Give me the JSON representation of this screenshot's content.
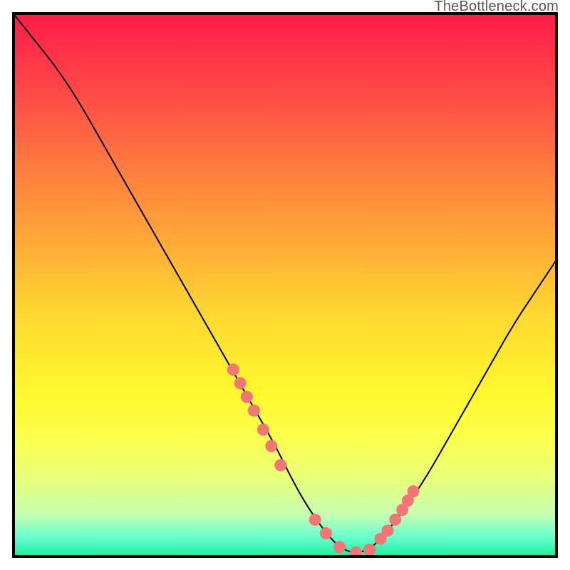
{
  "watermark": "TheBottleneck.com",
  "chart_data": {
    "type": "line",
    "title": "",
    "xlabel": "",
    "ylabel": "",
    "xlim": [
      0,
      100
    ],
    "ylim": [
      0,
      100
    ],
    "series": [
      {
        "name": "bottleneck-curve",
        "x": [
          0,
          4,
          8,
          12,
          16,
          20,
          24,
          28,
          32,
          36,
          40,
          44,
          48,
          52,
          55,
          58,
          60,
          62,
          64,
          66,
          68,
          72,
          76,
          80,
          84,
          88,
          92,
          96,
          100
        ],
        "y": [
          100,
          95,
          90,
          84,
          77,
          70,
          63,
          56,
          49,
          42,
          35,
          28,
          21,
          13,
          8,
          4,
          2,
          1,
          1,
          2,
          4,
          9,
          15,
          22,
          29,
          36,
          43,
          49,
          55
        ]
      }
    ],
    "markers": {
      "name": "highlight-dots",
      "x": [
        40.5,
        41.8,
        43.0,
        44.3,
        46.0,
        47.5,
        49.2,
        55.5,
        57.5,
        60.0,
        63.0,
        65.5,
        67.5,
        68.8,
        70.2,
        71.5,
        72.5,
        73.5
      ],
      "y": [
        34.5,
        32.0,
        29.5,
        27.0,
        23.5,
        20.5,
        17.0,
        7.0,
        4.5,
        2.0,
        1.0,
        1.5,
        3.5,
        5.0,
        7.0,
        8.8,
        10.5,
        12.2
      ]
    },
    "background_gradient": {
      "top": "#ff1a4a",
      "mid": "#fff82f",
      "bottom": "#14ee9c"
    }
  }
}
